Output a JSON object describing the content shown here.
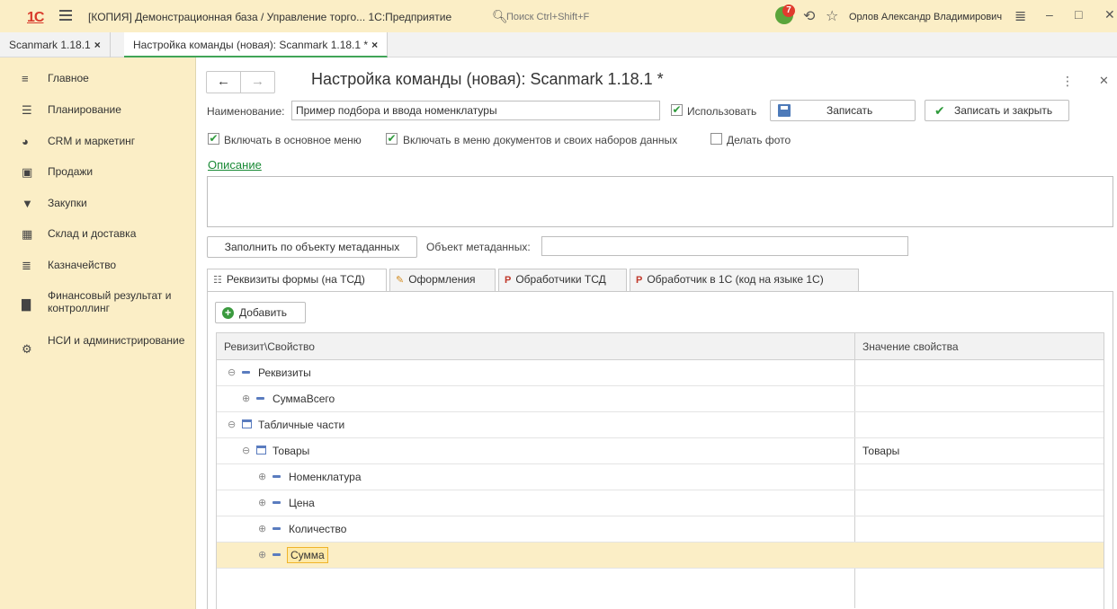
{
  "topbar": {
    "logo": "1С",
    "app_title": "[КОПИЯ] Демонстрационная база / Управление торго...  1С:Предприятие",
    "search_placeholder": "Поиск Ctrl+Shift+F",
    "notification_count": "7",
    "user_name": "Орлов Александр Владимирович"
  },
  "window_tabs": [
    {
      "label": "Scanmark 1.18.1",
      "close": "×"
    },
    {
      "label": "Настройка команды (новая): Scanmark 1.18.1 *",
      "close": "×"
    }
  ],
  "sidebar": {
    "items": [
      {
        "label": "Главное",
        "icon": "menu-lines-icon"
      },
      {
        "label": "Планирование",
        "icon": "chart-planning-icon"
      },
      {
        "label": "CRM и маркетинг",
        "icon": "pie-chart-icon"
      },
      {
        "label": "Продажи",
        "icon": "shopping-bag-icon"
      },
      {
        "label": "Закупки",
        "icon": "cart-icon"
      },
      {
        "label": "Склад и доставка",
        "icon": "warehouse-icon"
      },
      {
        "label": "Казначейство",
        "icon": "coins-icon"
      },
      {
        "label": "Финансовый результат и контроллинг",
        "icon": "bar-chart-icon"
      },
      {
        "label": "НСИ и администрирование",
        "icon": "gear-icon"
      }
    ]
  },
  "form": {
    "title": "Настройка команды (новая): Scanmark 1.18.1 *",
    "name_label": "Наименование:",
    "name_value": "Пример подбора и ввода номенклатуры",
    "use_label": "Использовать",
    "use_checked": true,
    "save_label": "Записать",
    "save_close_label": "Записать и закрыть",
    "include_main_menu_label": "Включать в основное меню",
    "include_main_menu_checked": true,
    "include_doc_menu_label": "Включать в меню документов и своих наборов данных",
    "include_doc_menu_checked": true,
    "take_photo_label": "Делать фото",
    "take_photo_checked": false,
    "description_link": "Описание",
    "description_value": "",
    "fill_button": "Заполнить по объекту метаданных",
    "metadata_label": "Объект метаданных:",
    "metadata_value": ""
  },
  "page_tabs": [
    {
      "label": "Реквизиты формы (на ТСД)",
      "icon": "form-icon",
      "active": true
    },
    {
      "label": "Оформления",
      "icon": "brush-icon",
      "active": false
    },
    {
      "label": "Обработчики ТСД",
      "icon": "handler-icon",
      "active": false
    },
    {
      "label": "Обработчик в 1С  (код на языке 1С)",
      "icon": "handler-1c-icon",
      "active": false
    }
  ],
  "add_button": "Добавить",
  "grid": {
    "columns": [
      "Ревизит\\Свойство",
      "Значение свойства"
    ],
    "rows": [
      {
        "text": "Реквизиты",
        "value": ""
      },
      {
        "text": "СуммаВсего",
        "value": ""
      },
      {
        "text": "Табличные части",
        "value": ""
      },
      {
        "text": "Товары",
        "value": "Товары"
      },
      {
        "text": "Номенклатура",
        "value": ""
      },
      {
        "text": "Цена",
        "value": ""
      },
      {
        "text": "Количество",
        "value": ""
      },
      {
        "text": "Сумма",
        "value": ""
      }
    ]
  },
  "colors": {
    "accent_bg": "#fbeec6",
    "green": "#2e9a3b",
    "red_badge": "#e03b2e"
  }
}
